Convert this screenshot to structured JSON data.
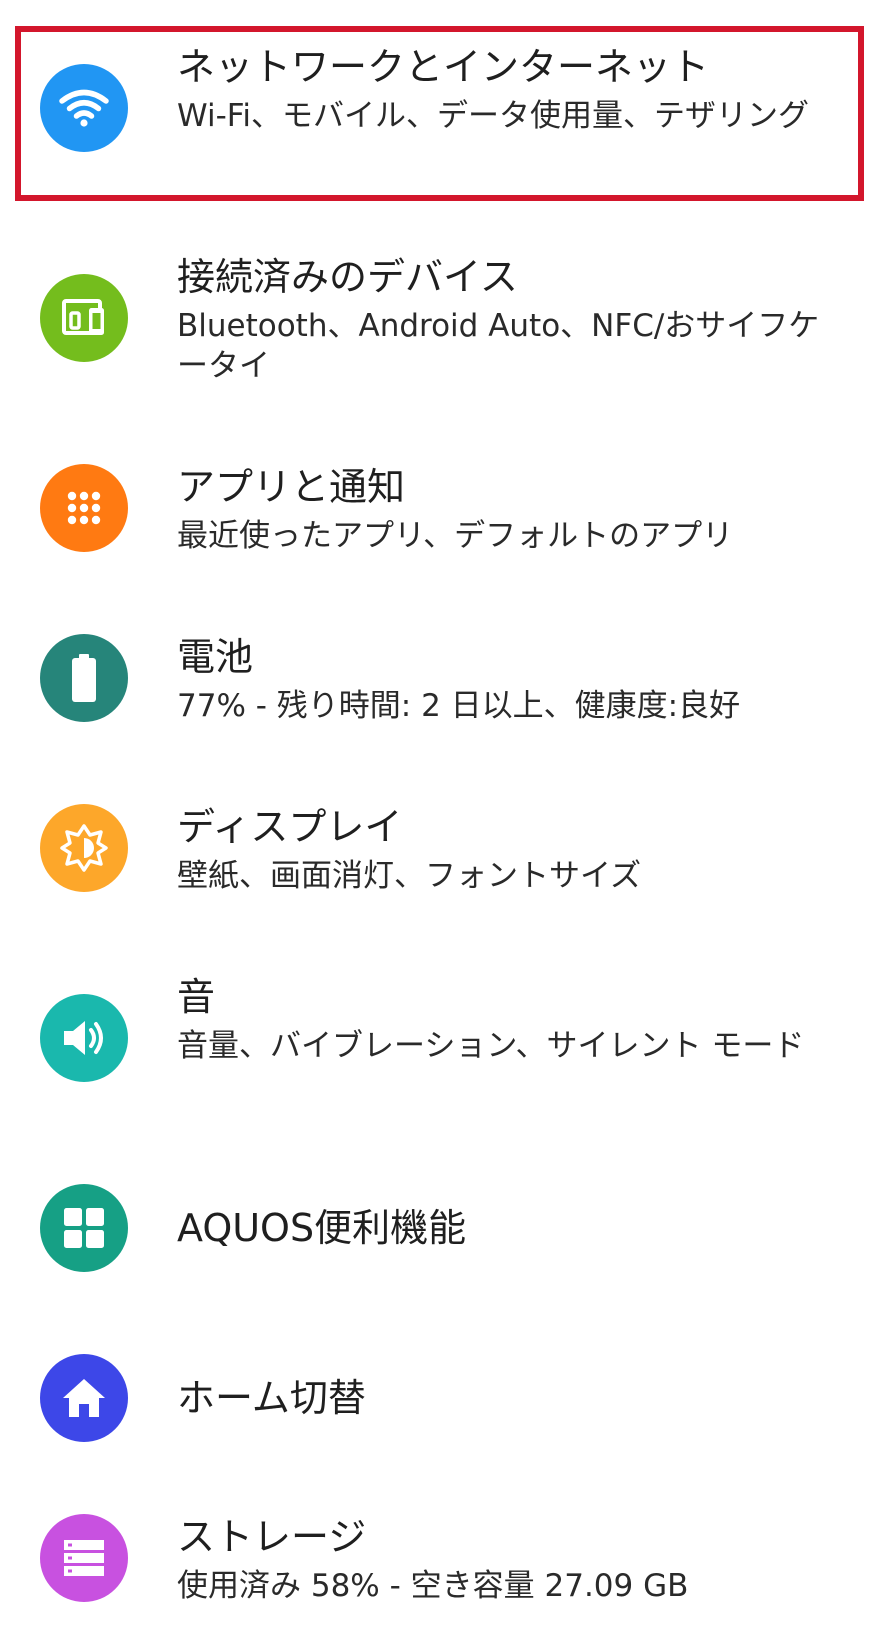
{
  "settings": {
    "items": [
      {
        "title": "ネットワークとインターネット",
        "summary": "Wi-Fi、モバイル、データ使用量、テザリング",
        "icon": "wifi-icon",
        "color": "#2196f3"
      },
      {
        "title": "接続済みのデバイス",
        "summary": "Bluetooth、Android Auto、NFC/おサイフケータイ",
        "icon": "devices-icon",
        "color": "#74bd1d"
      },
      {
        "title": "アプリと通知",
        "summary": "最近使ったアプリ、デフォルトのアプリ",
        "icon": "apps-icon",
        "color": "#ff7a12"
      },
      {
        "title": "電池",
        "summary": "77% - 残り時間: 2 日以上、健康度:良好",
        "icon": "battery-icon",
        "color": "#26857a"
      },
      {
        "title": "ディスプレイ",
        "summary": "壁紙、画面消灯、フォントサイズ",
        "icon": "brightness-icon",
        "color": "#fda72a"
      },
      {
        "title": "音",
        "summary": "音量、バイブレーション、サイレント モード",
        "icon": "volume-icon",
        "color": "#1ab8ad"
      },
      {
        "title": "AQUOS便利機能",
        "summary": "",
        "icon": "grid-icon",
        "color": "#16a085"
      },
      {
        "title": "ホーム切替",
        "summary": "",
        "icon": "home-icon",
        "color": "#3d47e8"
      },
      {
        "title": "ストレージ",
        "summary": "使用済み 58% - 空き容量 27.09 GB",
        "icon": "storage-icon",
        "color": "#c851e0"
      }
    ]
  },
  "highlight": {
    "color": "#d3162c"
  }
}
